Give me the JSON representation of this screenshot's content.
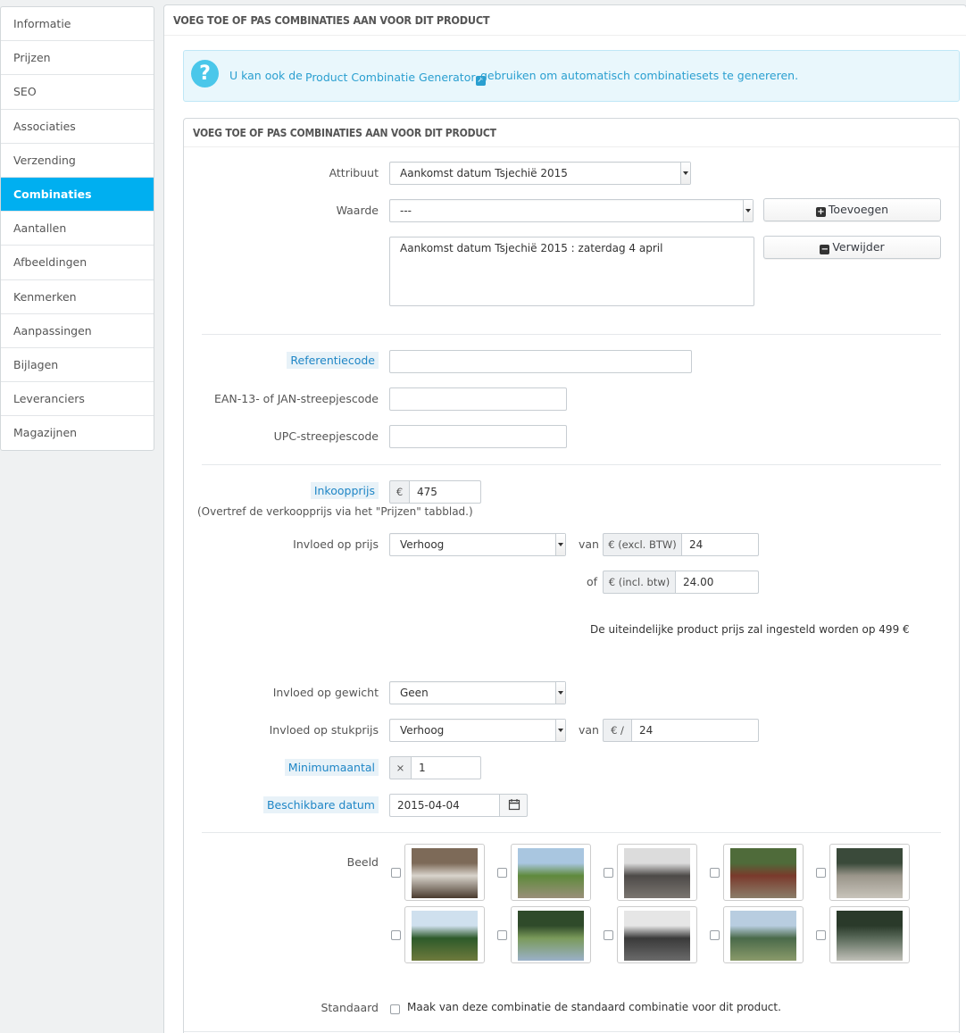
{
  "sidebar": {
    "items": [
      {
        "label": "Informatie",
        "active": false
      },
      {
        "label": "Prijzen",
        "active": false
      },
      {
        "label": "SEO",
        "active": false
      },
      {
        "label": "Associaties",
        "active": false
      },
      {
        "label": "Verzending",
        "active": false
      },
      {
        "label": "Combinaties",
        "active": true
      },
      {
        "label": "Aantallen",
        "active": false
      },
      {
        "label": "Afbeeldingen",
        "active": false
      },
      {
        "label": "Kenmerken",
        "active": false
      },
      {
        "label": "Aanpassingen",
        "active": false
      },
      {
        "label": "Bijlagen",
        "active": false
      },
      {
        "label": "Leveranciers",
        "active": false
      },
      {
        "label": "Magazijnen",
        "active": false
      }
    ]
  },
  "panel": {
    "title": "VOEG TOE OF PAS COMBINATIES AAN VOOR DIT PRODUCT",
    "alert": {
      "prefix": "U kan ook de",
      "link": "Product Combinatie Generator",
      "suffix": "gebruiken om automatisch combinatiesets te genereren."
    }
  },
  "form": {
    "title": "VOEG TOE OF PAS COMBINATIES AAN VOOR DIT PRODUCT",
    "attribute_label": "Attribuut",
    "attribute_value": "Aankomst datum Tsjechië 2015",
    "value_label": "Waarde",
    "value_value": "---",
    "add_button": "Toevoegen",
    "remove_button": "Verwijder",
    "selected_combination": "Aankomst datum Tsjechië 2015 : zaterdag 4 april",
    "reference_label": "Referentiecode",
    "reference_value": "",
    "ean_label": "EAN-13- of JAN-streepjescode",
    "ean_value": "",
    "upc_label": "UPC-streepjescode",
    "upc_value": "",
    "wholesale_label": "Inkoopprijs",
    "currency": "€",
    "wholesale_value": "475",
    "wholesale_note": "(Overtref de verkoopprijs via het \"Prijzen\" tabblad.)",
    "price_impact_label": "Invloed op prijs",
    "price_impact_value": "Verhoog",
    "van": "van",
    "excl_addon": "€ (excl. BTW)",
    "excl_value": "24",
    "of": "of",
    "incl_addon": "€ (incl. btw)",
    "incl_value": "24.00",
    "final_price_note": "De uiteindelijke product prijs zal ingesteld worden op 499 €",
    "weight_impact_label": "Invloed op gewicht",
    "weight_impact_value": "Geen",
    "unit_impact_label": "Invloed op stukprijs",
    "unit_impact_value": "Verhoog",
    "unit_addon": "€ /",
    "unit_value": "24",
    "min_qty_label": "Minimumaantal",
    "min_qty_addon": "×",
    "min_qty_value": "1",
    "available_date_label": "Beschikbare datum",
    "available_date_value": "2015-04-04",
    "image_label": "Beeld",
    "default_label": "Standaard",
    "default_text": "Maak van deze combinatie de standaard combinatie voor dit product."
  },
  "images": [
    {
      "name": "waterfall",
      "colors": [
        "#7d6a58",
        "#d9d4cc",
        "#4a3b2e"
      ]
    },
    {
      "name": "hill-view",
      "colors": [
        "#a9c6e0",
        "#5f8a3c",
        "#9a8f7a"
      ]
    },
    {
      "name": "castle-tower",
      "colors": [
        "#dcdcdc",
        "#4d4a48",
        "#7a7570"
      ]
    },
    {
      "name": "cabin",
      "colors": [
        "#4f6b3a",
        "#7a3a2c",
        "#8b7e6a"
      ]
    },
    {
      "name": "stone-river",
      "colors": [
        "#3a4a3a",
        "#9a958a",
        "#c8c4bb"
      ]
    },
    {
      "name": "pine-forest",
      "colors": [
        "#cfe0ee",
        "#2d5a2a",
        "#6e7a3c"
      ]
    },
    {
      "name": "forest-path",
      "colors": [
        "#2f4a2a",
        "#7a9a5a",
        "#9ab0c8"
      ]
    },
    {
      "name": "rock-ruins",
      "colors": [
        "#e6e6e6",
        "#3a3a3a",
        "#6a6a6a"
      ]
    },
    {
      "name": "valley-view",
      "colors": [
        "#b8cde0",
        "#4a6a4a",
        "#8a9a6a"
      ]
    },
    {
      "name": "forest-stream",
      "colors": [
        "#2a3a2a",
        "#5a6a5a",
        "#c0c0b8"
      ]
    }
  ]
}
